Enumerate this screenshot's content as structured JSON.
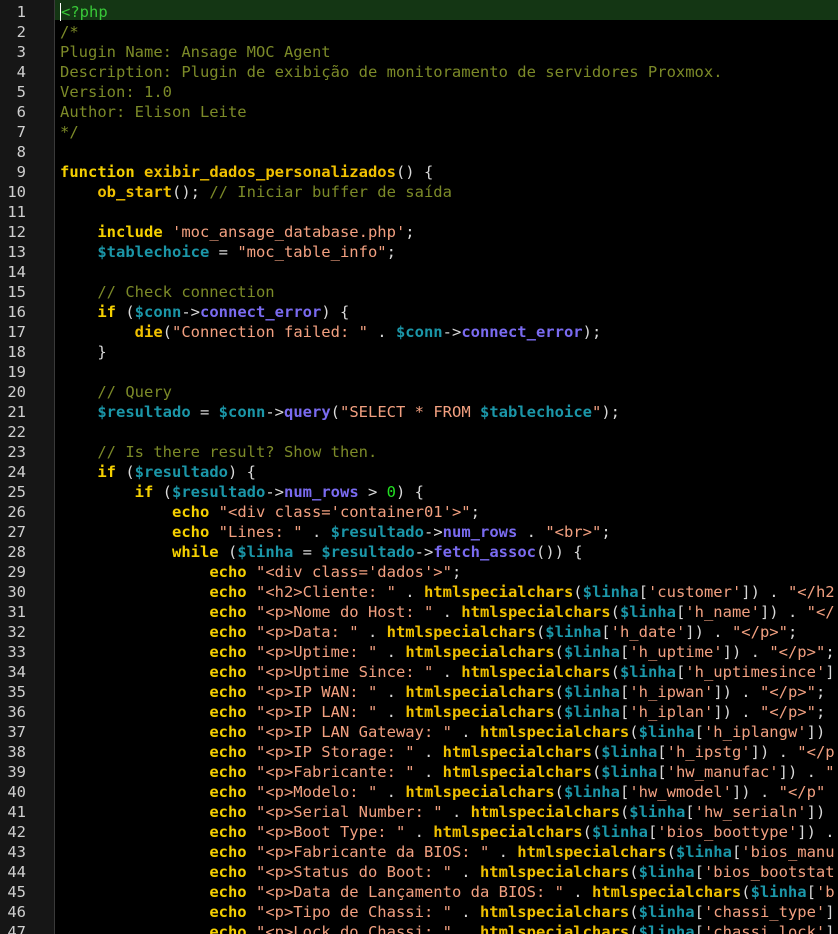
{
  "colors": {
    "background": "#000000",
    "gutter": "#161616",
    "current_line": "#143614",
    "keyword": "#f5d000",
    "function_call": "#f0c000",
    "variable": "#1b96a8",
    "property": "#7a6bf0",
    "string": "#f2a080",
    "comment": "#7c8a28",
    "php_tag": "#38c838",
    "number": "#22e022",
    "text": "#d8d8d8"
  },
  "editor": {
    "current_line": 1,
    "lines": [
      [
        [
          "t",
          "<?php"
        ]
      ],
      [
        [
          "c",
          "/*"
        ]
      ],
      [
        [
          "c",
          "Plugin Name: Ansage MOC Agent"
        ]
      ],
      [
        [
          "c",
          "Description: Plugin de exibição de monitoramento de servidores Proxmox."
        ]
      ],
      [
        [
          "c",
          "Version: 1.0"
        ]
      ],
      [
        [
          "c",
          "Author: Elison Leite"
        ]
      ],
      [
        [
          "c",
          "*/"
        ]
      ],
      [],
      [
        [
          "k",
          "function"
        ],
        [
          "o",
          " "
        ],
        [
          "f",
          "exibir_dados_personalizados"
        ],
        [
          "o",
          "() {"
        ]
      ],
      [
        [
          "o",
          "    "
        ],
        [
          "f",
          "ob_start"
        ],
        [
          "o",
          "(); "
        ],
        [
          "c",
          "// Iniciar buffer de saída"
        ]
      ],
      [],
      [
        [
          "o",
          "    "
        ],
        [
          "k",
          "include"
        ],
        [
          "o",
          " "
        ],
        [
          "s",
          "'moc_ansage_database.php'"
        ],
        [
          "o",
          ";"
        ]
      ],
      [
        [
          "o",
          "    "
        ],
        [
          "v",
          "$tablechoice"
        ],
        [
          "o",
          " = "
        ],
        [
          "s",
          "\"moc_table_info\""
        ],
        [
          "o",
          ";"
        ]
      ],
      [],
      [
        [
          "o",
          "    "
        ],
        [
          "c",
          "// Check connection"
        ]
      ],
      [
        [
          "o",
          "    "
        ],
        [
          "k",
          "if"
        ],
        [
          "o",
          " ("
        ],
        [
          "v",
          "$conn"
        ],
        [
          "o",
          "->"
        ],
        [
          "p",
          "connect_error"
        ],
        [
          "o",
          ") {"
        ]
      ],
      [
        [
          "o",
          "        "
        ],
        [
          "f",
          "die"
        ],
        [
          "o",
          "("
        ],
        [
          "s",
          "\"Connection failed: \""
        ],
        [
          "o",
          " . "
        ],
        [
          "v",
          "$conn"
        ],
        [
          "o",
          "->"
        ],
        [
          "p",
          "connect_error"
        ],
        [
          "o",
          ");"
        ]
      ],
      [
        [
          "o",
          "    }"
        ]
      ],
      [],
      [
        [
          "o",
          "    "
        ],
        [
          "c",
          "// Query"
        ]
      ],
      [
        [
          "o",
          "    "
        ],
        [
          "v",
          "$resultado"
        ],
        [
          "o",
          " = "
        ],
        [
          "v",
          "$conn"
        ],
        [
          "o",
          "->"
        ],
        [
          "p",
          "query"
        ],
        [
          "o",
          "("
        ],
        [
          "s",
          "\"SELECT * FROM "
        ],
        [
          "v",
          "$tablechoice"
        ],
        [
          "s",
          "\""
        ],
        [
          "o",
          ");"
        ]
      ],
      [],
      [
        [
          "o",
          "    "
        ],
        [
          "c",
          "// Is there result? Show then."
        ]
      ],
      [
        [
          "o",
          "    "
        ],
        [
          "k",
          "if"
        ],
        [
          "o",
          " ("
        ],
        [
          "v",
          "$resultado"
        ],
        [
          "o",
          ") {"
        ]
      ],
      [
        [
          "o",
          "        "
        ],
        [
          "k",
          "if"
        ],
        [
          "o",
          " ("
        ],
        [
          "v",
          "$resultado"
        ],
        [
          "o",
          "->"
        ],
        [
          "p",
          "num_rows"
        ],
        [
          "o",
          " > "
        ],
        [
          "n",
          "0"
        ],
        [
          "o",
          ") {"
        ]
      ],
      [
        [
          "o",
          "            "
        ],
        [
          "k",
          "echo"
        ],
        [
          "o",
          " "
        ],
        [
          "s",
          "\"<div class='container01'>\""
        ],
        [
          "o",
          ";"
        ]
      ],
      [
        [
          "o",
          "            "
        ],
        [
          "k",
          "echo"
        ],
        [
          "o",
          " "
        ],
        [
          "s",
          "\"Lines: \""
        ],
        [
          "o",
          " . "
        ],
        [
          "v",
          "$resultado"
        ],
        [
          "o",
          "->"
        ],
        [
          "p",
          "num_rows"
        ],
        [
          "o",
          " . "
        ],
        [
          "s",
          "\"<br>\""
        ],
        [
          "o",
          ";"
        ]
      ],
      [
        [
          "o",
          "            "
        ],
        [
          "k",
          "while"
        ],
        [
          "o",
          " ("
        ],
        [
          "v",
          "$linha"
        ],
        [
          "o",
          " = "
        ],
        [
          "v",
          "$resultado"
        ],
        [
          "o",
          "->"
        ],
        [
          "p",
          "fetch_assoc"
        ],
        [
          "o",
          "()) {"
        ]
      ],
      [
        [
          "o",
          "                "
        ],
        [
          "k",
          "echo"
        ],
        [
          "o",
          " "
        ],
        [
          "s",
          "\"<div class='dados'>\""
        ],
        [
          "o",
          ";"
        ]
      ],
      [
        [
          "o",
          "                "
        ],
        [
          "k",
          "echo"
        ],
        [
          "o",
          " "
        ],
        [
          "s",
          "\"<h2>Cliente: \""
        ],
        [
          "o",
          " . "
        ],
        [
          "f",
          "htmlspecialchars"
        ],
        [
          "o",
          "("
        ],
        [
          "v",
          "$linha"
        ],
        [
          "o",
          "["
        ],
        [
          "s",
          "'customer'"
        ],
        [
          "o",
          "]) . "
        ],
        [
          "s",
          "\"</h2"
        ]
      ],
      [
        [
          "o",
          "                "
        ],
        [
          "k",
          "echo"
        ],
        [
          "o",
          " "
        ],
        [
          "s",
          "\"<p>Nome do Host: \""
        ],
        [
          "o",
          " . "
        ],
        [
          "f",
          "htmlspecialchars"
        ],
        [
          "o",
          "("
        ],
        [
          "v",
          "$linha"
        ],
        [
          "o",
          "["
        ],
        [
          "s",
          "'h_name'"
        ],
        [
          "o",
          "]) . "
        ],
        [
          "s",
          "\"</"
        ]
      ],
      [
        [
          "o",
          "                "
        ],
        [
          "k",
          "echo"
        ],
        [
          "o",
          " "
        ],
        [
          "s",
          "\"<p>Data: \""
        ],
        [
          "o",
          " . "
        ],
        [
          "f",
          "htmlspecialchars"
        ],
        [
          "o",
          "("
        ],
        [
          "v",
          "$linha"
        ],
        [
          "o",
          "["
        ],
        [
          "s",
          "'h_date'"
        ],
        [
          "o",
          "]) . "
        ],
        [
          "s",
          "\"</p>\""
        ],
        [
          "o",
          ";"
        ]
      ],
      [
        [
          "o",
          "                "
        ],
        [
          "k",
          "echo"
        ],
        [
          "o",
          " "
        ],
        [
          "s",
          "\"<p>Uptime: \""
        ],
        [
          "o",
          " . "
        ],
        [
          "f",
          "htmlspecialchars"
        ],
        [
          "o",
          "("
        ],
        [
          "v",
          "$linha"
        ],
        [
          "o",
          "["
        ],
        [
          "s",
          "'h_uptime'"
        ],
        [
          "o",
          "]) . "
        ],
        [
          "s",
          "\"</p>\""
        ],
        [
          "o",
          ";"
        ]
      ],
      [
        [
          "o",
          "                "
        ],
        [
          "k",
          "echo"
        ],
        [
          "o",
          " "
        ],
        [
          "s",
          "\"<p>Uptime Since: \""
        ],
        [
          "o",
          " . "
        ],
        [
          "f",
          "htmlspecialchars"
        ],
        [
          "o",
          "("
        ],
        [
          "v",
          "$linha"
        ],
        [
          "o",
          "["
        ],
        [
          "s",
          "'h_uptimesince'"
        ],
        [
          "o",
          "]"
        ]
      ],
      [
        [
          "o",
          "                "
        ],
        [
          "k",
          "echo"
        ],
        [
          "o",
          " "
        ],
        [
          "s",
          "\"<p>IP WAN: \""
        ],
        [
          "o",
          " . "
        ],
        [
          "f",
          "htmlspecialchars"
        ],
        [
          "o",
          "("
        ],
        [
          "v",
          "$linha"
        ],
        [
          "o",
          "["
        ],
        [
          "s",
          "'h_ipwan'"
        ],
        [
          "o",
          "]) . "
        ],
        [
          "s",
          "\"</p>\""
        ],
        [
          "o",
          ";"
        ]
      ],
      [
        [
          "o",
          "                "
        ],
        [
          "k",
          "echo"
        ],
        [
          "o",
          " "
        ],
        [
          "s",
          "\"<p>IP LAN: \""
        ],
        [
          "o",
          " . "
        ],
        [
          "f",
          "htmlspecialchars"
        ],
        [
          "o",
          "("
        ],
        [
          "v",
          "$linha"
        ],
        [
          "o",
          "["
        ],
        [
          "s",
          "'h_iplan'"
        ],
        [
          "o",
          "]) . "
        ],
        [
          "s",
          "\"</p>\""
        ],
        [
          "o",
          ";"
        ]
      ],
      [
        [
          "o",
          "                "
        ],
        [
          "k",
          "echo"
        ],
        [
          "o",
          " "
        ],
        [
          "s",
          "\"<p>IP LAN Gateway: \""
        ],
        [
          "o",
          " . "
        ],
        [
          "f",
          "htmlspecialchars"
        ],
        [
          "o",
          "("
        ],
        [
          "v",
          "$linha"
        ],
        [
          "o",
          "["
        ],
        [
          "s",
          "'h_iplangw'"
        ],
        [
          "o",
          "])"
        ]
      ],
      [
        [
          "o",
          "                "
        ],
        [
          "k",
          "echo"
        ],
        [
          "o",
          " "
        ],
        [
          "s",
          "\"<p>IP Storage: \""
        ],
        [
          "o",
          " . "
        ],
        [
          "f",
          "htmlspecialchars"
        ],
        [
          "o",
          "("
        ],
        [
          "v",
          "$linha"
        ],
        [
          "o",
          "["
        ],
        [
          "s",
          "'h_ipstg'"
        ],
        [
          "o",
          "]) . "
        ],
        [
          "s",
          "\"</p"
        ]
      ],
      [
        [
          "o",
          "                "
        ],
        [
          "k",
          "echo"
        ],
        [
          "o",
          " "
        ],
        [
          "s",
          "\"<p>Fabricante: \""
        ],
        [
          "o",
          " . "
        ],
        [
          "f",
          "htmlspecialchars"
        ],
        [
          "o",
          "("
        ],
        [
          "v",
          "$linha"
        ],
        [
          "o",
          "["
        ],
        [
          "s",
          "'hw_manufac'"
        ],
        [
          "o",
          "]) . "
        ],
        [
          "s",
          "\""
        ]
      ],
      [
        [
          "o",
          "                "
        ],
        [
          "k",
          "echo"
        ],
        [
          "o",
          " "
        ],
        [
          "s",
          "\"<p>Modelo: \""
        ],
        [
          "o",
          " . "
        ],
        [
          "f",
          "htmlspecialchars"
        ],
        [
          "o",
          "("
        ],
        [
          "v",
          "$linha"
        ],
        [
          "o",
          "["
        ],
        [
          "s",
          "'hw_wmodel'"
        ],
        [
          "o",
          "]) . "
        ],
        [
          "s",
          "\"</p\""
        ]
      ],
      [
        [
          "o",
          "                "
        ],
        [
          "k",
          "echo"
        ],
        [
          "o",
          " "
        ],
        [
          "s",
          "\"<p>Serial Number: \""
        ],
        [
          "o",
          " . "
        ],
        [
          "f",
          "htmlspecialchars"
        ],
        [
          "o",
          "("
        ],
        [
          "v",
          "$linha"
        ],
        [
          "o",
          "["
        ],
        [
          "s",
          "'hw_serialn'"
        ],
        [
          "o",
          "])"
        ]
      ],
      [
        [
          "o",
          "                "
        ],
        [
          "k",
          "echo"
        ],
        [
          "o",
          " "
        ],
        [
          "s",
          "\"<p>Boot Type: \""
        ],
        [
          "o",
          " . "
        ],
        [
          "f",
          "htmlspecialchars"
        ],
        [
          "o",
          "("
        ],
        [
          "v",
          "$linha"
        ],
        [
          "o",
          "["
        ],
        [
          "s",
          "'bios_boottype'"
        ],
        [
          "o",
          "]) ."
        ]
      ],
      [
        [
          "o",
          "                "
        ],
        [
          "k",
          "echo"
        ],
        [
          "o",
          " "
        ],
        [
          "s",
          "\"<p>Fabricante da BIOS: \""
        ],
        [
          "o",
          " . "
        ],
        [
          "f",
          "htmlspecialchars"
        ],
        [
          "o",
          "("
        ],
        [
          "v",
          "$linha"
        ],
        [
          "o",
          "["
        ],
        [
          "s",
          "'bios_manu"
        ]
      ],
      [
        [
          "o",
          "                "
        ],
        [
          "k",
          "echo"
        ],
        [
          "o",
          " "
        ],
        [
          "s",
          "\"<p>Status do Boot: \""
        ],
        [
          "o",
          " . "
        ],
        [
          "f",
          "htmlspecialchars"
        ],
        [
          "o",
          "("
        ],
        [
          "v",
          "$linha"
        ],
        [
          "o",
          "["
        ],
        [
          "s",
          "'bios_bootstat"
        ]
      ],
      [
        [
          "o",
          "                "
        ],
        [
          "k",
          "echo"
        ],
        [
          "o",
          " "
        ],
        [
          "s",
          "\"<p>Data de Lançamento da BIOS: \""
        ],
        [
          "o",
          " . "
        ],
        [
          "f",
          "htmlspecialchars"
        ],
        [
          "o",
          "("
        ],
        [
          "v",
          "$linha"
        ],
        [
          "o",
          "["
        ],
        [
          "s",
          "'b"
        ]
      ],
      [
        [
          "o",
          "                "
        ],
        [
          "k",
          "echo"
        ],
        [
          "o",
          " "
        ],
        [
          "s",
          "\"<p>Tipo de Chassi: \""
        ],
        [
          "o",
          " . "
        ],
        [
          "f",
          "htmlspecialchars"
        ],
        [
          "o",
          "("
        ],
        [
          "v",
          "$linha"
        ],
        [
          "o",
          "["
        ],
        [
          "s",
          "'chassi_type'"
        ],
        [
          "o",
          "]"
        ]
      ],
      [
        [
          "o",
          "                "
        ],
        [
          "k",
          "echo"
        ],
        [
          "o",
          " "
        ],
        [
          "s",
          "\"<p>Lock do Chassi: \""
        ],
        [
          "o",
          " . "
        ],
        [
          "f",
          "htmlspecialchars"
        ],
        [
          "o",
          "("
        ],
        [
          "v",
          "$linha"
        ],
        [
          "o",
          "["
        ],
        [
          "s",
          "'chassi_lock'"
        ],
        [
          "o",
          "]"
        ]
      ]
    ]
  }
}
